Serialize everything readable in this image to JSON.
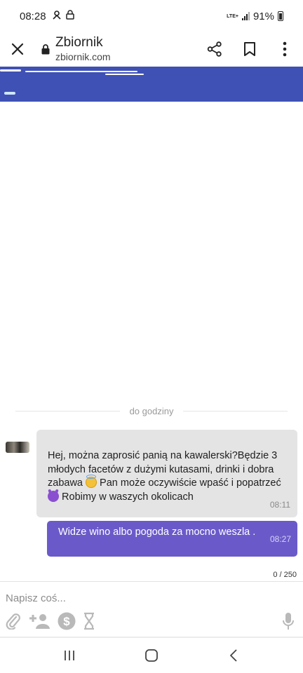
{
  "status_bar": {
    "time": "08:28",
    "network": "LTE+",
    "battery": "91%"
  },
  "toolbar": {
    "title": "Zbiornik",
    "url": "zbiornik.com"
  },
  "header": {
    "color": "#3f51b5"
  },
  "chat": {
    "divider_label": "do godziny",
    "incoming": {
      "text_part1": "Hej, można zaprosić panią na kawalerski?Będzie 3 młodych facetów z dużymi kutasami, drinki i dobra zabawa ",
      "emoji1": "smiling-face-with-halo",
      "text_part2": " Pan może oczywiście wpaść i popatrzeć ",
      "emoji2": "smiling-face-with-horns",
      "text_part3": " Robimy w waszych okolicach",
      "time": "08:11",
      "bubble_color": "#e4e4e4"
    },
    "outgoing": {
      "text": "Widze wino albo pogoda za mocno weszla .",
      "time": "08:27",
      "bubble_color": "#6a5ac9"
    }
  },
  "compose": {
    "counter": "0 / 250",
    "placeholder": "Napisz coś...",
    "actions": [
      "paperclip-icon",
      "add-user-icon",
      "dollar-icon",
      "hourglass-icon",
      "microphone-icon"
    ]
  },
  "navigation": {
    "buttons": [
      "recent-apps-icon",
      "home-icon",
      "back-icon"
    ]
  }
}
